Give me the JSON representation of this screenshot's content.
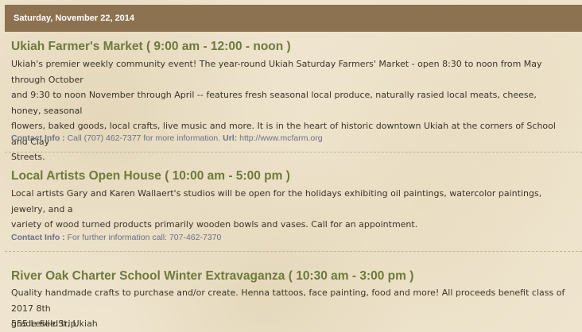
{
  "date_header": "Saturday, November 22, 2014",
  "events": [
    {
      "title": "Ukiah Farmer's Market ( 9:00 am - 12:00 - noon )",
      "description_lines": [
        "Ukiah's premier weekly community event! The year-round Ukiah Saturday Farmers' Market - open 8:30 to noon from May through October",
        "and 9:30 to noon November through April -- features fresh seasonal local produce, naturally rasied local meats, cheese, honey, seasonal",
        "flowers, baked goods, local crafts, live music and more. It is in the heart of historic downtown Ukiah at the corners of School and Clay",
        "Streets."
      ],
      "contact_label": "Contact Info :",
      "contact_text": "Call (707) 462-7377 for more information.",
      "url_label": "Url:",
      "url": "http://www.mcfarm.org"
    },
    {
      "title": "Local Artists Open House ( 10:00 am - 5:00 pm )",
      "description_lines": [
        "Local artists Gary and Karen Wallaert's studios will be open for the holidays exhibiting oil paintings, watercolor paintings, jewelry, and a",
        "variety of wood turned products primarily wooden bowls and vases.  Call for an appointment."
      ],
      "contact_label": "Contact Info :",
      "contact_text": "For further information call: 707-462-7370"
    },
    {
      "title": "River Oak Charter School Winter Extravaganza ( 10:30 am - 3:00 pm )",
      "description_lines": [
        "Quality handmade crafts to purchase and/or create.  Henna tattoos, face painting, food and more!  All proceeds benefit class of 2017 8th",
        "grade field trip."
      ],
      "address": "555 Leslie St, Ukiah"
    }
  ]
}
